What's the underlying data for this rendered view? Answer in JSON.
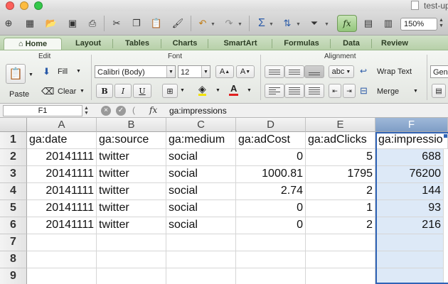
{
  "window": {
    "title": "test-uplo"
  },
  "toolbar": {
    "zoom": "150%"
  },
  "tabs": [
    "Home",
    "Layout",
    "Tables",
    "Charts",
    "SmartArt",
    "Formulas",
    "Data",
    "Review"
  ],
  "ribbon": {
    "groups": {
      "edit": "Edit",
      "font": "Font",
      "alignment": "Alignment"
    },
    "paste": "Paste",
    "fill": "Fill",
    "clear": "Clear",
    "font_name": "Calibri (Body)",
    "font_size": "12",
    "bold": "B",
    "italic": "I",
    "underline": "U",
    "font_grow": "A",
    "font_shrink": "A",
    "font_color_letter": "A",
    "orientation": "abc",
    "wrap_text": "Wrap Text",
    "merge": "Merge",
    "number_format": "Gen"
  },
  "formula_bar": {
    "name_box": "F1",
    "fx": "fx",
    "formula": "ga:impressions"
  },
  "sheet": {
    "columns": [
      "A",
      "B",
      "C",
      "D",
      "E",
      "F"
    ],
    "row_numbers": [
      "1",
      "2",
      "3",
      "4",
      "5",
      "6",
      "7",
      "8",
      "9"
    ],
    "header": [
      "ga:date",
      "ga:source",
      "ga:medium",
      "ga:adCost",
      "ga:adClicks",
      "ga:impressio"
    ],
    "rows": [
      [
        "20141111",
        "twitter",
        "social",
        "0",
        "5",
        "688"
      ],
      [
        "20141111",
        "twitter",
        "social",
        "1000.81",
        "1795",
        "76200"
      ],
      [
        "20141111",
        "twitter",
        "social",
        "2.74",
        "2",
        "144"
      ],
      [
        "20141111",
        "twitter",
        "social",
        "0",
        "1",
        "93"
      ],
      [
        "20141111",
        "twitter",
        "social",
        "0",
        "2",
        "216"
      ]
    ],
    "selected_cell": "F1"
  },
  "colors": {
    "tab_bar": "#b7d0a9",
    "selection": "#2f63b6",
    "selected_column": "#dde9f7"
  }
}
